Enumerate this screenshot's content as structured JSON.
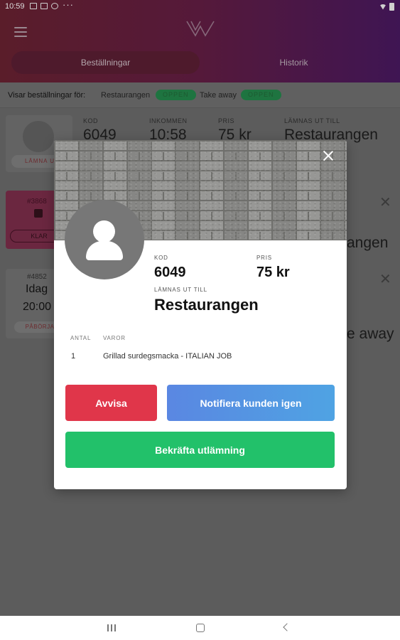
{
  "status_bar": {
    "time": "10:59",
    "dots": "···",
    "icons": [
      "photo-icon",
      "screen-icon",
      "settings-icon",
      "wifi-icon",
      "battery-icon"
    ]
  },
  "header": {
    "menu_icon": "hamburger-menu-icon",
    "logo_icon": "w-logo-icon",
    "tabs": [
      {
        "label": "Beställningar",
        "active": true
      },
      {
        "label": "Historik",
        "active": false
      }
    ],
    "colors": {
      "gradient_start": "#5a1d2a",
      "gradient_end": "#3f1553"
    }
  },
  "filter_bar": {
    "label": "Visar beställningar för:",
    "items": [
      {
        "name": "Restaurangen",
        "status": "OPPEN"
      },
      {
        "name": "Take away",
        "status": "OPPEN"
      }
    ]
  },
  "background_orders": [
    {
      "code_label": "KOD",
      "code": "6049",
      "received_label": "INKOMMEN",
      "received": "10:58",
      "price_label": "PRIS",
      "price": "75 kr",
      "delivered_label": "LÄMNAS UT TILL",
      "delivered_to": "Restaurangen",
      "button": "LÄMNA U"
    },
    {
      "number": "#3868",
      "button": "KLAR",
      "delivered_to": "angen"
    },
    {
      "number": "#4852",
      "day": "Idag",
      "time": "20:00",
      "button": "PÅBÖRJA",
      "delivered_to": "e away"
    }
  ],
  "modal": {
    "code_label": "KOD",
    "code": "6049",
    "price_label": "PRIS",
    "price": "75 kr",
    "delivered_label": "LÄMNAS UT TILL",
    "delivered_to": "Restaurangen",
    "table_headers": {
      "qty": "ANTAL",
      "items": "VAROR"
    },
    "items": [
      {
        "qty": "1",
        "name": "Grillad surdegsmacka - ITALIAN JOB"
      }
    ],
    "buttons": {
      "reject": "Avvisa",
      "notify": "Notifiera kunden igen",
      "confirm": "Bekräfta utlämning"
    },
    "colors": {
      "reject": "#e0364a",
      "notify": "#5a87e2",
      "confirm": "#22c16a"
    }
  },
  "navigation": {
    "icons": [
      "recent-apps-icon",
      "home-icon",
      "back-icon"
    ]
  }
}
